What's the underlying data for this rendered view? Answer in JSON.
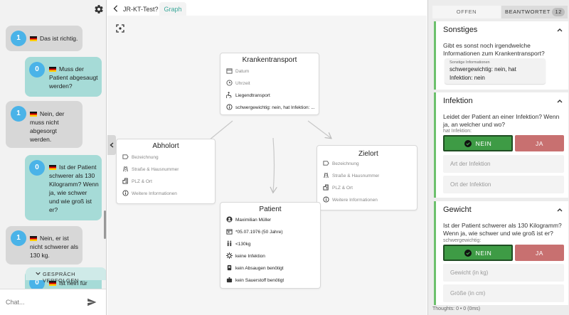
{
  "chat": {
    "messages": [
      {
        "side": "left",
        "count": "1",
        "text": "Das ist richtig."
      },
      {
        "side": "right",
        "count": "0",
        "lines": [
          "Muss der",
          "Patient abgesaugt",
          "werden?"
        ]
      },
      {
        "side": "left",
        "count": "1",
        "lines": [
          "Nein, der",
          "muss nicht",
          "abgesorgt",
          "werden."
        ]
      },
      {
        "side": "right",
        "count": "0",
        "lines": [
          "Ist der Patient",
          "schwerer als 130",
          "Kilogramm? Wenn",
          "ja, wie schwer",
          "und wie groß ist",
          "er?"
        ]
      },
      {
        "side": "left",
        "count": "1",
        "lines": [
          "Nein, er ist",
          "nicht schwerer als",
          "130 kg."
        ]
      },
      {
        "side": "right",
        "count": "0",
        "lines": [
          "Ist nein für"
        ]
      }
    ],
    "follow_label": "GESPRÄCH VERFOLGEN",
    "input_placeholder": "Chat..."
  },
  "tabs": {
    "title": "JR-KT-Test?",
    "active": "Graph"
  },
  "graph": {
    "krankentransport": {
      "title": "Krankentransport",
      "fields": [
        {
          "icon": "calendar-icon",
          "text": "Datum",
          "filled": false
        },
        {
          "icon": "clock-icon",
          "text": "Uhrzeit",
          "filled": false
        },
        {
          "icon": "wheelchair-icon",
          "text": "Liegendtransport",
          "filled": true
        },
        {
          "icon": "info-icon",
          "text": "schwergewichtig: nein, hat Infektion: ...",
          "filled": true
        }
      ]
    },
    "abholort": {
      "title": "Abholort",
      "fields": [
        {
          "icon": "label-icon",
          "text": "Bezeichnung"
        },
        {
          "icon": "road-icon",
          "text": "Straße & Hausnummer"
        },
        {
          "icon": "city-icon",
          "text": "PLZ & Ort"
        },
        {
          "icon": "info-icon",
          "text": "Weitere Informationen"
        }
      ]
    },
    "zielort": {
      "title": "Zielort",
      "fields": [
        {
          "icon": "label-icon",
          "text": "Bezeichnung"
        },
        {
          "icon": "road-icon",
          "text": "Straße & Hausnummer"
        },
        {
          "icon": "city-icon",
          "text": "PLZ & Ort"
        },
        {
          "icon": "info-icon",
          "text": "Weitere Informationen"
        }
      ]
    },
    "patient": {
      "title": "Patient",
      "fields": [
        {
          "icon": "person-icon",
          "text": "Maximilian Müller"
        },
        {
          "icon": "birthday-icon",
          "text": "*05.07.1976 (50 Jahre)"
        },
        {
          "icon": "weight-icon",
          "text": "<130kg"
        },
        {
          "icon": "virus-icon",
          "text": "keine Infektion"
        },
        {
          "icon": "suction-icon",
          "text": "kein Absaugen benötigt"
        },
        {
          "icon": "oxygen-icon",
          "text": "kein Sauerstoff benötigt"
        }
      ]
    }
  },
  "right": {
    "tab_open": "OFFEN",
    "tab_answered": "BEANTWORTET",
    "answered_count": "12",
    "sonstiges": {
      "title": "Sonstiges",
      "question": "Gibt es sonst noch irgendwelche Informationen zum Krankentransport?",
      "field_label": "Sonstige Informationen",
      "field_line1": "schwergewichtig: nein, hat",
      "field_line2": "Infektion: nein"
    },
    "infektion": {
      "title": "Infektion",
      "question": "Leidet der Patient an einer Infektion? Wenn ja, an welcher und wo?",
      "toggle_label": "hat Infektion:",
      "no_label": "NEIN",
      "yes_label": "JA",
      "field1_placeholder": "Art der Infektion",
      "field2_placeholder": "Ort der Infektion"
    },
    "gewicht": {
      "title": "Gewicht",
      "question": "Ist der Patient schwerer als 130 Kilogramm? Wenn ja, wie schwer und wie groß ist er?",
      "toggle_label": "schwergewichtig:",
      "no_label": "NEIN",
      "yes_label": "JA",
      "field1_placeholder": "Gewicht (in kg)",
      "field2_placeholder": "Größe (in cm)"
    },
    "thoughts": "Thoughts: 0 • 0 (0ms)"
  },
  "colors": {
    "teal_bubble": "#a6dbd7",
    "grey_bubble": "#d7d7d7",
    "count_badge": "#4ab3e8",
    "yes_no_green": "#3e9b45",
    "yes_red": "#c87070",
    "card_accent": "#6cc06c",
    "graph_tab": "#3aa89a"
  }
}
